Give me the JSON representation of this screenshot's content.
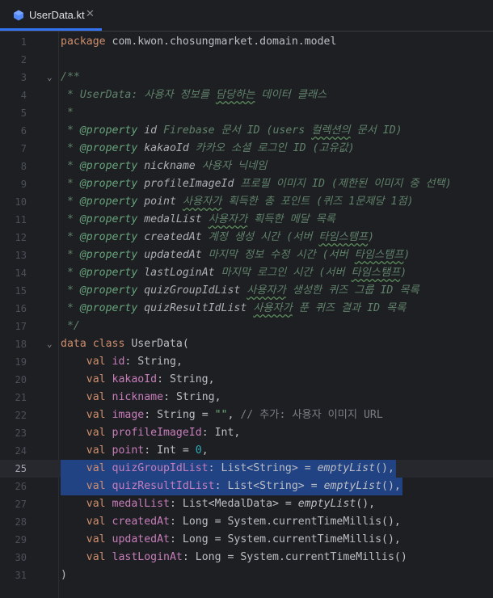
{
  "tab": {
    "filename": "UserData.kt",
    "close": "✕"
  },
  "colors": {
    "accent": "#3574f0",
    "selection": "#214283",
    "background": "#1e1f22"
  },
  "lines": [
    {
      "n": "1",
      "parts": [
        {
          "c": "kw",
          "t": "package "
        },
        {
          "c": "",
          "t": "com.kwon.chosungmarket.domain.model"
        }
      ]
    },
    {
      "n": "2",
      "parts": []
    },
    {
      "n": "3",
      "fold": "⌄",
      "parts": [
        {
          "c": "doc",
          "t": "/**"
        }
      ]
    },
    {
      "n": "4",
      "parts": [
        {
          "c": "doc",
          "t": " * UserData: 사용자 정보를 "
        },
        {
          "c": "doc wavy",
          "t": "담당하는"
        },
        {
          "c": "doc",
          "t": " 데이터 클래스"
        }
      ]
    },
    {
      "n": "5",
      "parts": [
        {
          "c": "doc",
          "t": " *"
        }
      ]
    },
    {
      "n": "6",
      "parts": [
        {
          "c": "doc",
          "t": " * "
        },
        {
          "c": "tag",
          "t": "@property "
        },
        {
          "c": "param",
          "t": "id"
        },
        {
          "c": "doc",
          "t": " Firebase 문서 ID (users "
        },
        {
          "c": "doc wavy",
          "t": "컬렉션의"
        },
        {
          "c": "doc",
          "t": " 문서 ID)"
        }
      ]
    },
    {
      "n": "7",
      "parts": [
        {
          "c": "doc",
          "t": " * "
        },
        {
          "c": "tag",
          "t": "@property "
        },
        {
          "c": "param",
          "t": "kakaoId"
        },
        {
          "c": "doc",
          "t": " 카카오 소셜 로그인 ID (고유값)"
        }
      ]
    },
    {
      "n": "8",
      "parts": [
        {
          "c": "doc",
          "t": " * "
        },
        {
          "c": "tag",
          "t": "@property "
        },
        {
          "c": "param",
          "t": "nickname"
        },
        {
          "c": "doc",
          "t": " 사용자 닉네임"
        }
      ]
    },
    {
      "n": "9",
      "parts": [
        {
          "c": "doc",
          "t": " * "
        },
        {
          "c": "tag",
          "t": "@property "
        },
        {
          "c": "param",
          "t": "profileImageId"
        },
        {
          "c": "doc",
          "t": " 프로필 이미지 ID (제한된 이미지 중 선택)"
        }
      ]
    },
    {
      "n": "10",
      "parts": [
        {
          "c": "doc",
          "t": " * "
        },
        {
          "c": "tag",
          "t": "@property "
        },
        {
          "c": "param",
          "t": "point"
        },
        {
          "c": "doc",
          "t": " "
        },
        {
          "c": "doc wavy",
          "t": "사용자가"
        },
        {
          "c": "doc",
          "t": " 획득한 총 포인트 (퀴즈 1문제당 1점)"
        }
      ]
    },
    {
      "n": "11",
      "parts": [
        {
          "c": "doc",
          "t": " * "
        },
        {
          "c": "tag",
          "t": "@property "
        },
        {
          "c": "param",
          "t": "medalList"
        },
        {
          "c": "doc",
          "t": " "
        },
        {
          "c": "doc wavy",
          "t": "사용자가"
        },
        {
          "c": "doc",
          "t": " 획득한 메달 목록"
        }
      ]
    },
    {
      "n": "12",
      "parts": [
        {
          "c": "doc",
          "t": " * "
        },
        {
          "c": "tag",
          "t": "@property "
        },
        {
          "c": "param",
          "t": "createdAt"
        },
        {
          "c": "doc",
          "t": " 계정 생성 시간 (서버 "
        },
        {
          "c": "doc wavy",
          "t": "타임스탬프"
        },
        {
          "c": "doc",
          "t": ")"
        }
      ]
    },
    {
      "n": "13",
      "parts": [
        {
          "c": "doc",
          "t": " * "
        },
        {
          "c": "tag",
          "t": "@property "
        },
        {
          "c": "param",
          "t": "updatedAt"
        },
        {
          "c": "doc",
          "t": " 마지막 정보 수정 시간 (서버 "
        },
        {
          "c": "doc wavy",
          "t": "타임스탬프"
        },
        {
          "c": "doc",
          "t": ")"
        }
      ]
    },
    {
      "n": "14",
      "parts": [
        {
          "c": "doc",
          "t": " * "
        },
        {
          "c": "tag",
          "t": "@property "
        },
        {
          "c": "param",
          "t": "lastLoginAt"
        },
        {
          "c": "doc",
          "t": " 마지막 로그인 시간 (서버 "
        },
        {
          "c": "doc wavy",
          "t": "타임스탬프"
        },
        {
          "c": "doc",
          "t": ")"
        }
      ]
    },
    {
      "n": "15",
      "parts": [
        {
          "c": "doc",
          "t": " * "
        },
        {
          "c": "tag",
          "t": "@property "
        },
        {
          "c": "param",
          "t": "quizGroupIdList"
        },
        {
          "c": "doc",
          "t": " "
        },
        {
          "c": "doc wavy",
          "t": "사용자가"
        },
        {
          "c": "doc",
          "t": " 생성한 퀴즈 그룹 ID 목록"
        }
      ]
    },
    {
      "n": "16",
      "parts": [
        {
          "c": "doc",
          "t": " * "
        },
        {
          "c": "tag",
          "t": "@property "
        },
        {
          "c": "param",
          "t": "quizResultIdList"
        },
        {
          "c": "doc",
          "t": " "
        },
        {
          "c": "doc wavy",
          "t": "사용자가"
        },
        {
          "c": "doc",
          "t": " 푼 퀴즈 결과 ID 목록"
        }
      ]
    },
    {
      "n": "17",
      "parts": [
        {
          "c": "doc",
          "t": " */"
        }
      ]
    },
    {
      "n": "18",
      "fold": "⌄",
      "parts": [
        {
          "c": "kw",
          "t": "data class "
        },
        {
          "c": "",
          "t": "UserData("
        }
      ]
    },
    {
      "n": "19",
      "parts": [
        {
          "c": "kw",
          "t": "    val "
        },
        {
          "c": "fld",
          "t": "id"
        },
        {
          "c": "",
          "t": ": String,"
        }
      ]
    },
    {
      "n": "20",
      "parts": [
        {
          "c": "kw",
          "t": "    val "
        },
        {
          "c": "fld",
          "t": "kakaoId"
        },
        {
          "c": "",
          "t": ": String,"
        }
      ]
    },
    {
      "n": "21",
      "parts": [
        {
          "c": "kw",
          "t": "    val "
        },
        {
          "c": "fld",
          "t": "nickname"
        },
        {
          "c": "",
          "t": ": String,"
        }
      ]
    },
    {
      "n": "22",
      "parts": [
        {
          "c": "kw",
          "t": "    val "
        },
        {
          "c": "fld",
          "t": "image"
        },
        {
          "c": "",
          "t": ": String = "
        },
        {
          "c": "str",
          "t": "\"\""
        },
        {
          "c": "",
          "t": ", "
        },
        {
          "c": "cmt",
          "t": "// 추가: 사용자 이미지 URL"
        }
      ]
    },
    {
      "n": "23",
      "parts": [
        {
          "c": "kw",
          "t": "    val "
        },
        {
          "c": "fld",
          "t": "profileImageId"
        },
        {
          "c": "",
          "t": ": Int,"
        }
      ]
    },
    {
      "n": "24",
      "parts": [
        {
          "c": "kw",
          "t": "    val "
        },
        {
          "c": "fld",
          "t": "point"
        },
        {
          "c": "",
          "t": ": Int = "
        },
        {
          "c": "num",
          "t": "0"
        },
        {
          "c": "",
          "t": ","
        }
      ]
    },
    {
      "n": "25",
      "current": true,
      "parts": [
        {
          "c": "kw",
          "t": "    val "
        },
        {
          "c": "fld",
          "t": "quizGroupIdList"
        },
        {
          "c": "",
          "t": ": List<String> = "
        },
        {
          "c": "fn",
          "t": "emptyList"
        },
        {
          "c": "",
          "t": "(),"
        }
      ]
    },
    {
      "n": "26",
      "parts": [
        {
          "c": "kw",
          "t": "    val "
        },
        {
          "c": "fld",
          "t": "quizResultIdList"
        },
        {
          "c": "",
          "t": ": List<String> = "
        },
        {
          "c": "fn",
          "t": "emptyList"
        },
        {
          "c": "",
          "t": "(),"
        }
      ]
    },
    {
      "n": "27",
      "parts": [
        {
          "c": "kw",
          "t": "    val "
        },
        {
          "c": "fld",
          "t": "medalList"
        },
        {
          "c": "",
          "t": ": List<MedalData> = "
        },
        {
          "c": "fn",
          "t": "emptyList"
        },
        {
          "c": "",
          "t": "(),"
        }
      ]
    },
    {
      "n": "28",
      "parts": [
        {
          "c": "kw",
          "t": "    val "
        },
        {
          "c": "fld",
          "t": "createdAt"
        },
        {
          "c": "",
          "t": ": Long = System.currentTimeMillis(),"
        }
      ]
    },
    {
      "n": "29",
      "parts": [
        {
          "c": "kw",
          "t": "    val "
        },
        {
          "c": "fld",
          "t": "updatedAt"
        },
        {
          "c": "",
          "t": ": Long = System.currentTimeMillis(),"
        }
      ]
    },
    {
      "n": "30",
      "parts": [
        {
          "c": "kw",
          "t": "    val "
        },
        {
          "c": "fld",
          "t": "lastLoginAt"
        },
        {
          "c": "",
          "t": ": Long = System.currentTimeMillis()"
        }
      ]
    },
    {
      "n": "31",
      "parts": [
        {
          "c": "",
          "t": ")"
        }
      ]
    }
  ]
}
